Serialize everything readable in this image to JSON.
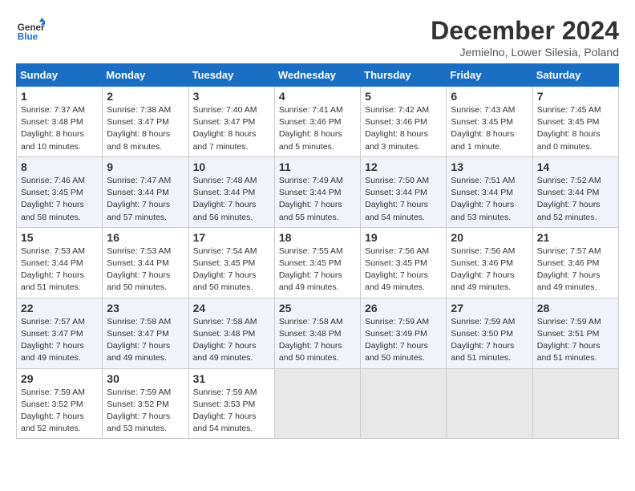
{
  "header": {
    "logo_line1": "General",
    "logo_line2": "Blue",
    "title": "December 2024",
    "subtitle": "Jemielno, Lower Silesia, Poland"
  },
  "weekdays": [
    "Sunday",
    "Monday",
    "Tuesday",
    "Wednesday",
    "Thursday",
    "Friday",
    "Saturday"
  ],
  "weeks": [
    [
      {
        "day": "1",
        "sr": "7:37 AM",
        "ss": "3:48 PM",
        "dl": "8 hours and 10 minutes."
      },
      {
        "day": "2",
        "sr": "7:38 AM",
        "ss": "3:47 PM",
        "dl": "8 hours and 8 minutes."
      },
      {
        "day": "3",
        "sr": "7:40 AM",
        "ss": "3:47 PM",
        "dl": "8 hours and 7 minutes."
      },
      {
        "day": "4",
        "sr": "7:41 AM",
        "ss": "3:46 PM",
        "dl": "8 hours and 5 minutes."
      },
      {
        "day": "5",
        "sr": "7:42 AM",
        "ss": "3:46 PM",
        "dl": "8 hours and 3 minutes."
      },
      {
        "day": "6",
        "sr": "7:43 AM",
        "ss": "3:45 PM",
        "dl": "8 hours and 1 minute."
      },
      {
        "day": "7",
        "sr": "7:45 AM",
        "ss": "3:45 PM",
        "dl": "8 hours and 0 minutes."
      }
    ],
    [
      {
        "day": "8",
        "sr": "7:46 AM",
        "ss": "3:45 PM",
        "dl": "7 hours and 58 minutes."
      },
      {
        "day": "9",
        "sr": "7:47 AM",
        "ss": "3:44 PM",
        "dl": "7 hours and 57 minutes."
      },
      {
        "day": "10",
        "sr": "7:48 AM",
        "ss": "3:44 PM",
        "dl": "7 hours and 56 minutes."
      },
      {
        "day": "11",
        "sr": "7:49 AM",
        "ss": "3:44 PM",
        "dl": "7 hours and 55 minutes."
      },
      {
        "day": "12",
        "sr": "7:50 AM",
        "ss": "3:44 PM",
        "dl": "7 hours and 54 minutes."
      },
      {
        "day": "13",
        "sr": "7:51 AM",
        "ss": "3:44 PM",
        "dl": "7 hours and 53 minutes."
      },
      {
        "day": "14",
        "sr": "7:52 AM",
        "ss": "3:44 PM",
        "dl": "7 hours and 52 minutes."
      }
    ],
    [
      {
        "day": "15",
        "sr": "7:53 AM",
        "ss": "3:44 PM",
        "dl": "7 hours and 51 minutes."
      },
      {
        "day": "16",
        "sr": "7:53 AM",
        "ss": "3:44 PM",
        "dl": "7 hours and 50 minutes."
      },
      {
        "day": "17",
        "sr": "7:54 AM",
        "ss": "3:45 PM",
        "dl": "7 hours and 50 minutes."
      },
      {
        "day": "18",
        "sr": "7:55 AM",
        "ss": "3:45 PM",
        "dl": "7 hours and 49 minutes."
      },
      {
        "day": "19",
        "sr": "7:56 AM",
        "ss": "3:45 PM",
        "dl": "7 hours and 49 minutes."
      },
      {
        "day": "20",
        "sr": "7:56 AM",
        "ss": "3:46 PM",
        "dl": "7 hours and 49 minutes."
      },
      {
        "day": "21",
        "sr": "7:57 AM",
        "ss": "3:46 PM",
        "dl": "7 hours and 49 minutes."
      }
    ],
    [
      {
        "day": "22",
        "sr": "7:57 AM",
        "ss": "3:47 PM",
        "dl": "7 hours and 49 minutes."
      },
      {
        "day": "23",
        "sr": "7:58 AM",
        "ss": "3:47 PM",
        "dl": "7 hours and 49 minutes."
      },
      {
        "day": "24",
        "sr": "7:58 AM",
        "ss": "3:48 PM",
        "dl": "7 hours and 49 minutes."
      },
      {
        "day": "25",
        "sr": "7:58 AM",
        "ss": "3:48 PM",
        "dl": "7 hours and 50 minutes."
      },
      {
        "day": "26",
        "sr": "7:59 AM",
        "ss": "3:49 PM",
        "dl": "7 hours and 50 minutes."
      },
      {
        "day": "27",
        "sr": "7:59 AM",
        "ss": "3:50 PM",
        "dl": "7 hours and 51 minutes."
      },
      {
        "day": "28",
        "sr": "7:59 AM",
        "ss": "3:51 PM",
        "dl": "7 hours and 51 minutes."
      }
    ],
    [
      {
        "day": "29",
        "sr": "7:59 AM",
        "ss": "3:52 PM",
        "dl": "7 hours and 52 minutes."
      },
      {
        "day": "30",
        "sr": "7:59 AM",
        "ss": "3:52 PM",
        "dl": "7 hours and 53 minutes."
      },
      {
        "day": "31",
        "sr": "7:59 AM",
        "ss": "3:53 PM",
        "dl": "7 hours and 54 minutes."
      },
      null,
      null,
      null,
      null
    ]
  ]
}
